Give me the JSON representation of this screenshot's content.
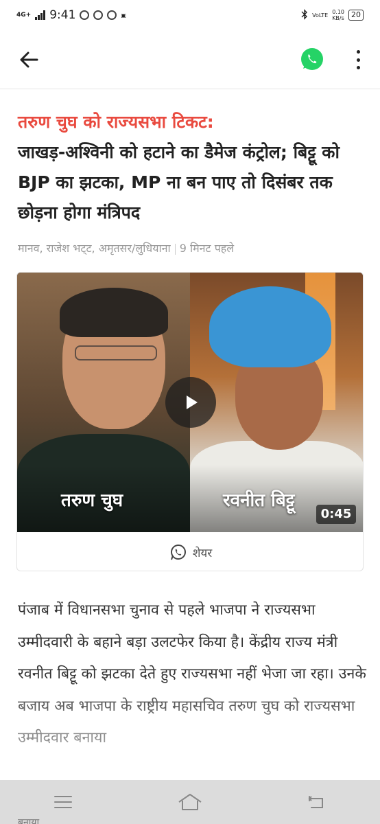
{
  "status_bar": {
    "network": "4G+",
    "time": "9:41",
    "volte": "VoLTE",
    "speed_value": "0.10",
    "speed_unit": "KB/s",
    "battery": "20"
  },
  "app_bar": {
    "back_icon": "arrow-left-icon",
    "share_icon": "whatsapp-icon",
    "menu_icon": "more-vert-icon",
    "whatsapp_color": "#25d366"
  },
  "article": {
    "kicker": "तरुण चुघ को राज्यसभा टिकट:",
    "headline": "जाखड़-अश्विनी को हटाने का डैमेज कंट्रोल; बिट्टू को BJP का झटका, MP ना बन पाए तो दिसंबर तक छोड़ना होगा मंत्रिपद",
    "byline": "मानव, राजेश भट्‌ट, अमृतसर/लुधियाना",
    "time_ago": "9 मिनट पहले",
    "kicker_color": "#e94a3f"
  },
  "video": {
    "left_name": "तरुण चुघ",
    "right_name": "रवनीत बिट्टू",
    "duration": "0:45",
    "play_icon": "play-icon",
    "share_label": "शेयर"
  },
  "body": {
    "paragraph": "पंजाब में विधानसभा चुनाव से पहले भाजपा ने राज्यसभा उम्मीदवारी के बहाने बड़ा उलटफेर किया है। केंद्रीय राज्य मंत्री रवनीत बिट्टू को झटका देते हुए राज्यसभा नहीं भेजा जा रहा। उनके बजाय अब भाजपा के राष्ट्रीय महासचिव तरुण चुघ को राज्यसभा उम्मीदवार बनाया",
    "peek": "बनाया"
  },
  "nav_bar": {
    "menu_icon": "hamburger-icon",
    "home_icon": "home-icon",
    "back_icon": "back-icon"
  }
}
